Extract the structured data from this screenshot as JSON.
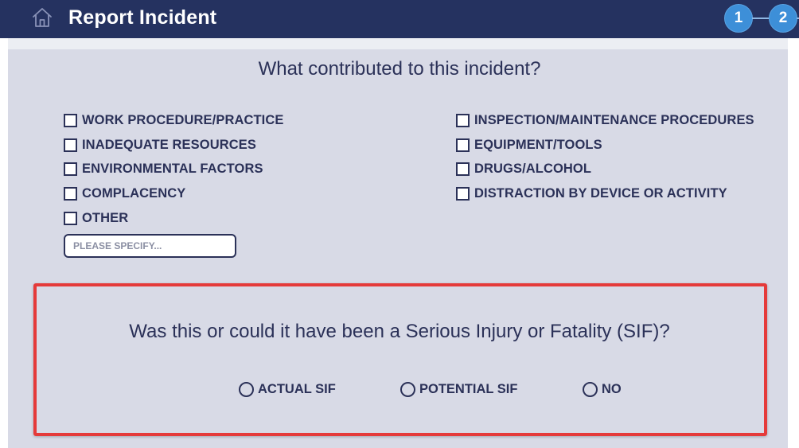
{
  "header": {
    "title": "Report Incident",
    "steps": [
      "1",
      "2"
    ]
  },
  "contributors": {
    "question": "What contributed to this incident?",
    "left": [
      "WORK PROCEDURE/PRACTICE",
      "INADEQUATE RESOURCES",
      "ENVIRONMENTAL FACTORS",
      "COMPLACENCY",
      "OTHER"
    ],
    "right": [
      "INSPECTION/MAINTENANCE PROCEDURES",
      "EQUIPMENT/TOOLS",
      "DRUGS/ALCOHOL",
      "DISTRACTION BY DEVICE OR ACTIVITY"
    ],
    "specify_placeholder": "PLEASE SPECIFY...",
    "specify_value": ""
  },
  "sif": {
    "question": "Was this or could it have been a Serious Injury or Fatality (SIF)?",
    "options": [
      "ACTUAL SIF",
      "POTENTIAL SIF",
      "NO"
    ]
  },
  "colors": {
    "header_bg": "#253260",
    "panel_bg": "#d8dae6",
    "step_accent": "#3d8fd8",
    "highlight_border": "#e53a3a",
    "text": "#2b3158"
  }
}
